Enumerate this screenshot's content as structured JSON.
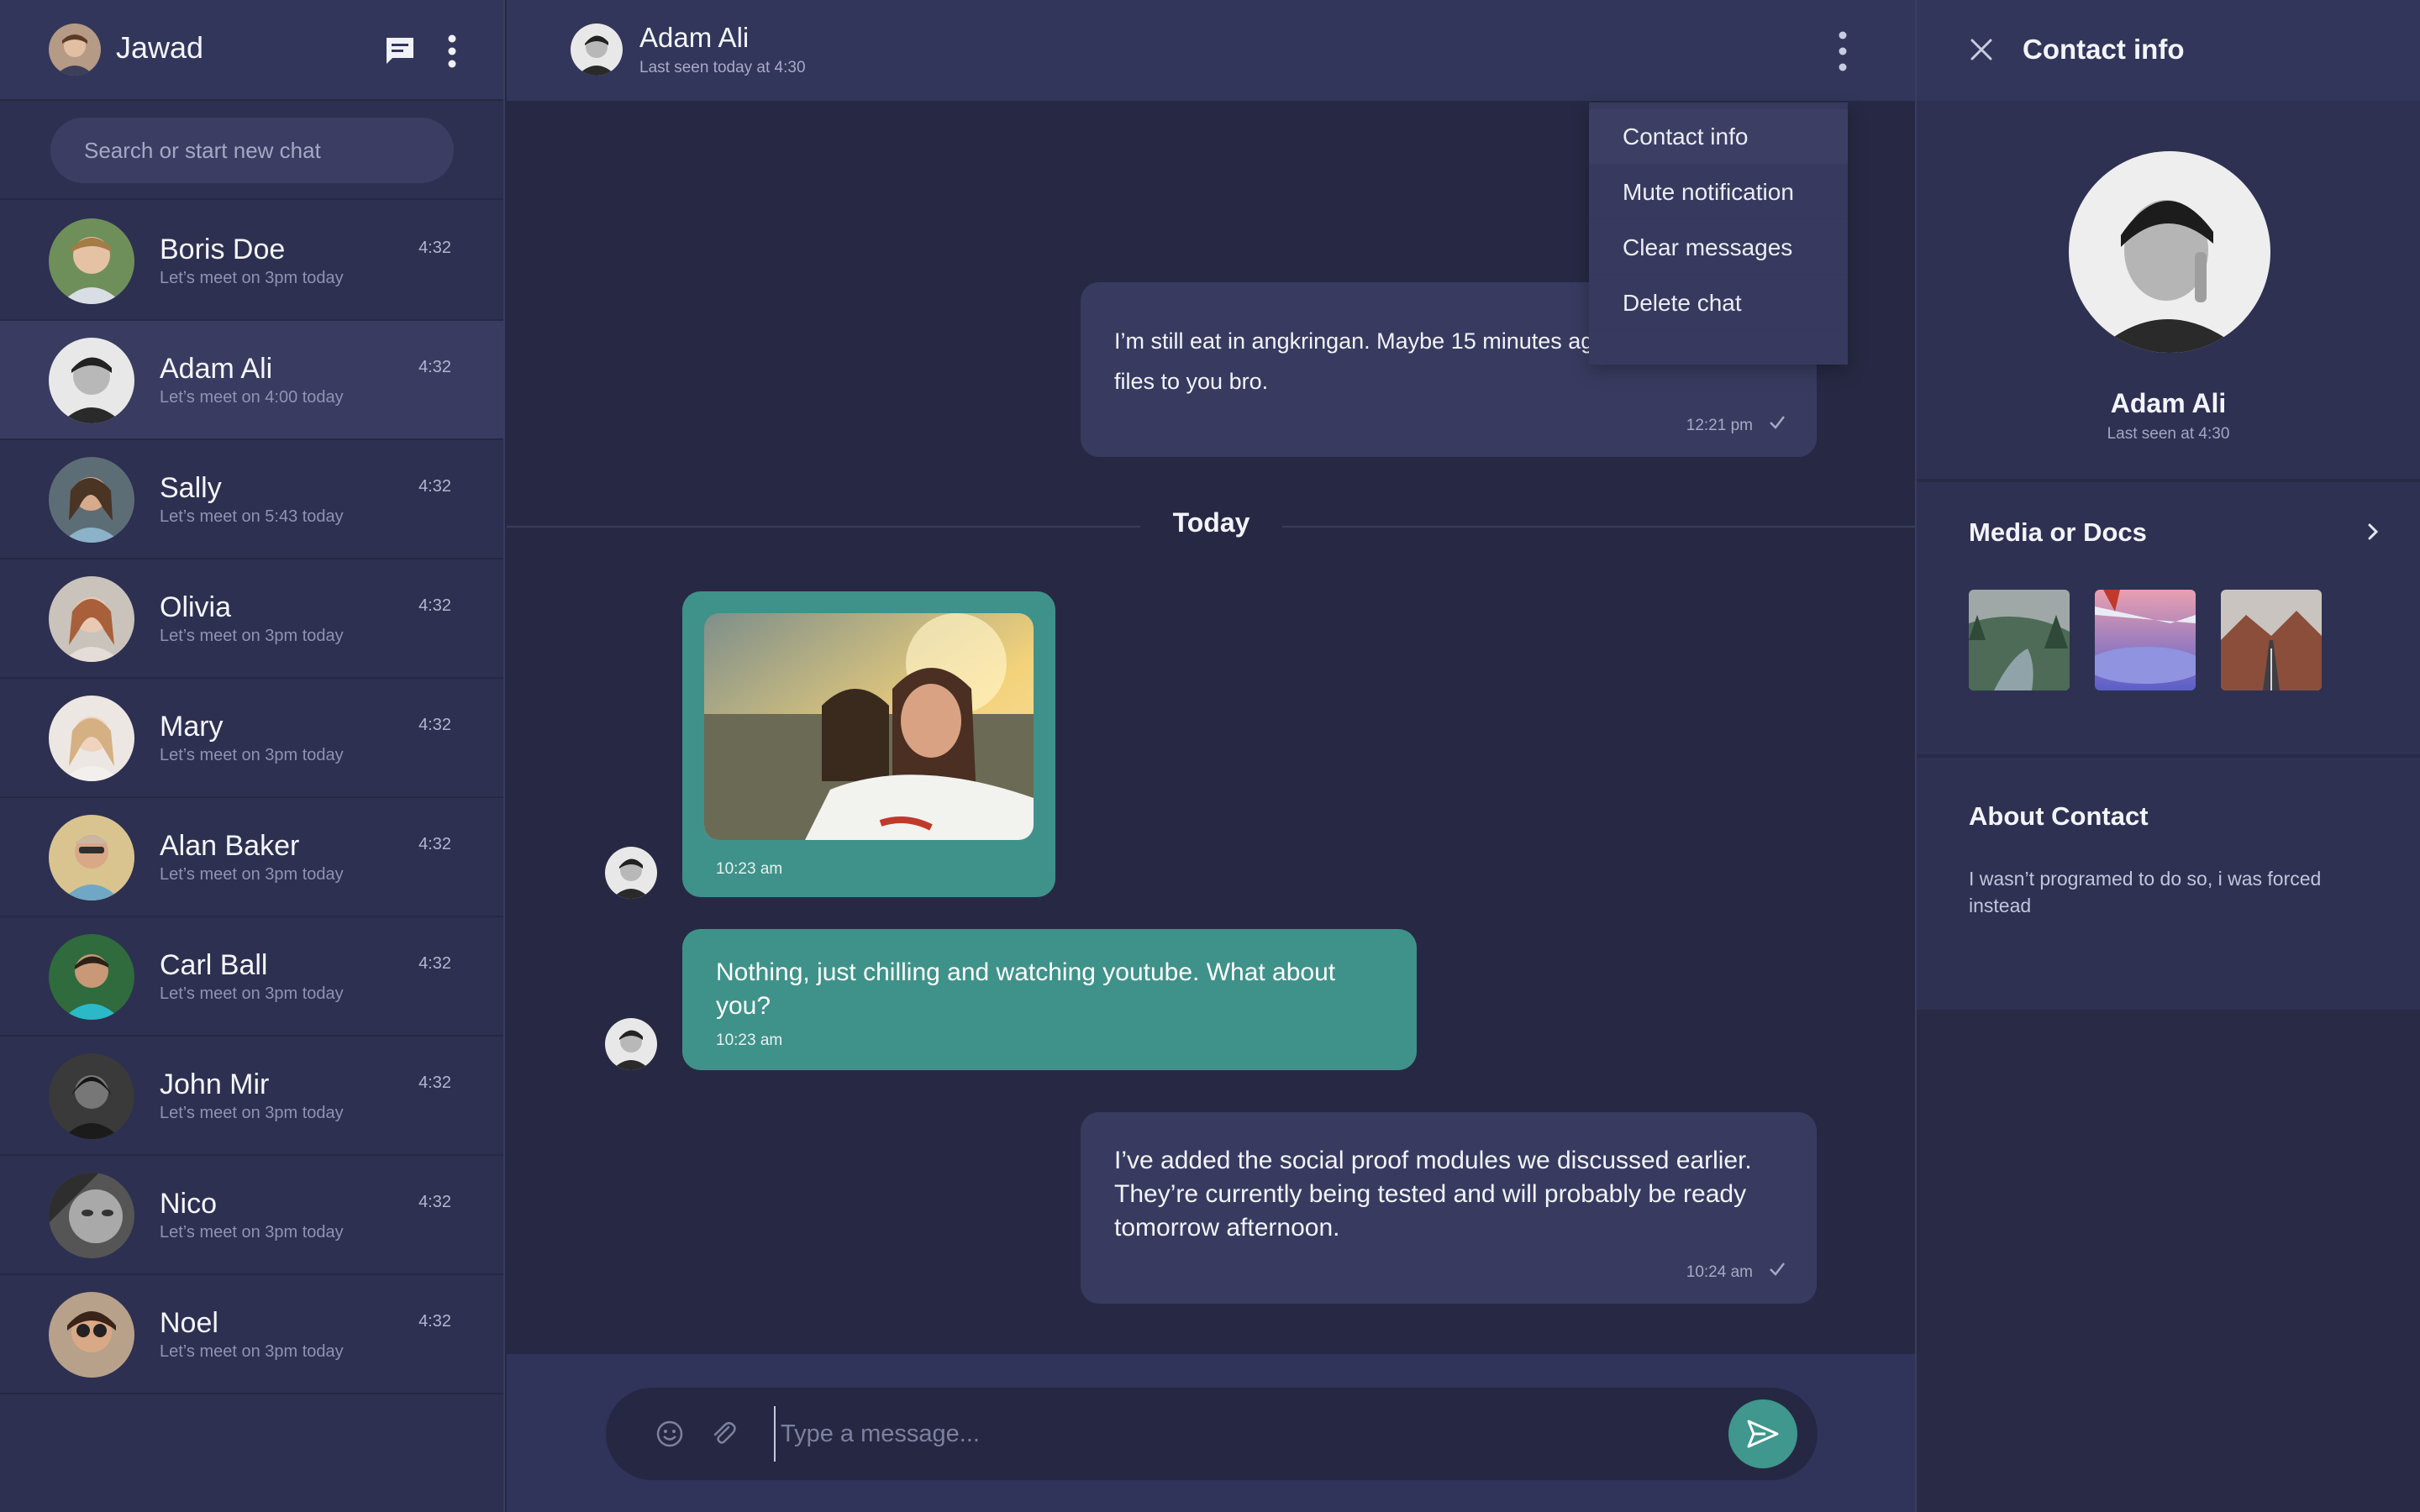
{
  "colors": {
    "background": "#262843",
    "panel": "#2d3050",
    "header": "#32365a",
    "incoming_bubble": "#3f928a",
    "outgoing_bubble": "#383b5f",
    "accent": "#3f978d"
  },
  "sidebar": {
    "user_name": "Jawad",
    "new_chat_icon": "chat-bubble-icon",
    "menu_icon": "vertical-dots-icon",
    "search": {
      "placeholder": "Search or start new chat"
    },
    "chats": [
      {
        "name": "Boris Doe",
        "preview": "Let’s meet on 3pm today",
        "time": "4:32"
      },
      {
        "name": "Adam Ali",
        "preview": "Let’s meet on 4:00 today",
        "time": "4:32"
      },
      {
        "name": "Sally",
        "preview": "Let’s meet on 5:43 today",
        "time": "4:32"
      },
      {
        "name": "Olivia",
        "preview": "Let’s meet on 3pm today",
        "time": "4:32"
      },
      {
        "name": "Mary",
        "preview": "Let’s meet on 3pm today",
        "time": "4:32"
      },
      {
        "name": "Alan Baker",
        "preview": "Let’s meet on 3pm today",
        "time": "4:32"
      },
      {
        "name": "Carl Ball",
        "preview": "Let’s meet on 3pm today",
        "time": "4:32"
      },
      {
        "name": "John Mir",
        "preview": "Let’s meet on 3pm today",
        "time": "4:32"
      },
      {
        "name": "Nico",
        "preview": "Let’s meet on 3pm today",
        "time": "4:32"
      },
      {
        "name": "Noel",
        "preview": "Let’s meet on 3pm today",
        "time": "4:32"
      }
    ]
  },
  "chat": {
    "contact_name": "Adam Ali",
    "contact_status": "Last seen today at 4:30",
    "menu": {
      "items": [
        "Contact info",
        "Mute notification",
        "Clear messages",
        "Delete chat"
      ]
    },
    "messages": [
      {
        "direction": "out",
        "text": "I’m still eat in angkringan. Maybe 15 minutes again i’ll send the files to you bro.",
        "time": "12:21 pm"
      },
      {
        "direction": "in",
        "type": "image",
        "time": "10:23 am"
      },
      {
        "direction": "in",
        "text": "Nothing, just chilling and watching youtube. What about you?",
        "time": "10:23 am"
      },
      {
        "direction": "out",
        "text": "I’ve added the social proof modules we discussed earlier. They’re currently being tested and will probably be ready tomorrow afternoon.",
        "time": "10:24 am"
      }
    ],
    "divider_label": "Today",
    "composer": {
      "placeholder": "Type a message..."
    }
  },
  "contact_info": {
    "title": "Contact info",
    "name": "Adam Ali",
    "status": "Last seen at 4:30",
    "media_title": "Media or Docs",
    "about_title": "About Contact",
    "about_text": "I wasn’t programed to do so, i was forced instead"
  }
}
